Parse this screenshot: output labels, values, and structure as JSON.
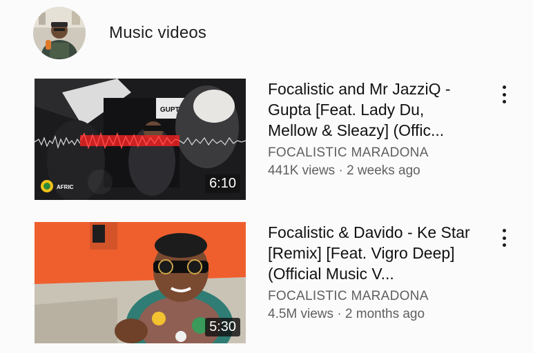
{
  "section": {
    "title": "Music videos"
  },
  "videos": [
    {
      "title": "Focalistic and Mr JazziQ - Gupta [Feat. Lady Du, Mellow & Sleazy] (Offic...",
      "channel": "FOCALISTIC MARADONA",
      "views": "441K views",
      "separator": "·",
      "age": "2 weeks ago",
      "duration": "6:10",
      "thumb_text": "GUPTA",
      "thumb_logo": "AFRIC"
    },
    {
      "title": "Focalistic & Davido - Ke Star [Remix] [Feat. Vigro Deep] (Official Music V...",
      "channel": "FOCALISTIC MARADONA",
      "views": "4.5M views",
      "separator": "·",
      "age": "2 months ago",
      "duration": "5:30"
    }
  ],
  "icons": {
    "avatar": "channel-avatar",
    "menu": "more-vert-icon"
  },
  "colors": {
    "background": "#fbfbfb",
    "text_primary": "#111111",
    "text_secondary": "#5f5f5f",
    "duration_bg": "#121212",
    "waveform_red": "#e02020"
  }
}
